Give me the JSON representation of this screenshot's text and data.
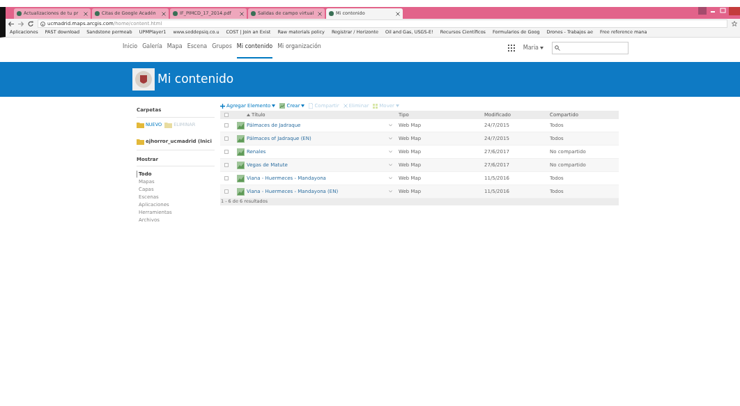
{
  "browser": {
    "tabs": [
      {
        "label": "Actualizaciones de tu pr",
        "selected": false
      },
      {
        "label": "Citas de Google Acadén",
        "selected": false
      },
      {
        "label": "IF_PIMCD_17_2014.pdf",
        "selected": false
      },
      {
        "label": "Salidas de campo virtual",
        "selected": false
      },
      {
        "label": "Mi contenido",
        "selected": true
      }
    ],
    "url_host": "ucmadrid.maps.arcgis.com",
    "url_path": "/home/content.html",
    "bookmarks": [
      "Aplicaciones",
      "PAST download",
      "Sandstone permeab",
      "UPMPlayer1",
      "www.seddepsiq.co.u",
      "COST | Join an Exist",
      "Raw materials policy",
      "Registrar / Horizonte",
      "Oil and Gas, USGS-E!",
      "Recursos Científicos",
      "Formularios de Goog",
      "Drones - Trabajos ae",
      "Free reference mana"
    ]
  },
  "nav": {
    "items": [
      {
        "label": "Inicio",
        "selected": false
      },
      {
        "label": "Galería",
        "selected": false
      },
      {
        "label": "Mapa",
        "selected": false
      },
      {
        "label": "Escena",
        "selected": false
      },
      {
        "label": "Grupos",
        "selected": false
      },
      {
        "label": "Mi contenido",
        "selected": true
      },
      {
        "label": "Mi organización",
        "selected": false
      }
    ],
    "user": "Maria"
  },
  "header": {
    "title": "Mi contenido"
  },
  "sidebar": {
    "folders_heading": "Carpetas",
    "folder_actions": [
      {
        "label": "NUEVO",
        "disabled": false
      },
      {
        "label": "ELIMINAR",
        "disabled": true
      }
    ],
    "folders": [
      "ejhorror_ucmadrid (Inici"
    ],
    "show_heading": "Mostrar",
    "filters": [
      {
        "label": "Todo",
        "selected": true
      },
      {
        "label": "Mapas",
        "selected": false
      },
      {
        "label": "Capas",
        "selected": false
      },
      {
        "label": "Escenas",
        "selected": false
      },
      {
        "label": "Aplicaciones",
        "selected": false
      },
      {
        "label": "Herramientas",
        "selected": false
      },
      {
        "label": "Archivos",
        "selected": false
      }
    ]
  },
  "toolbar": [
    {
      "label": "Agregar Elemento",
      "kind": "add",
      "disabled": false
    },
    {
      "label": "Crear",
      "kind": "create",
      "disabled": false
    },
    {
      "label": "Compartir",
      "kind": "share",
      "disabled": true
    },
    {
      "label": "Eliminar",
      "kind": "delete",
      "disabled": true
    },
    {
      "label": "Mover",
      "kind": "move",
      "disabled": true
    }
  ],
  "table": {
    "select_all_checked": false,
    "columns": [
      "Título",
      "Tipo",
      "Modificado",
      "Compartido"
    ],
    "rows": [
      {
        "title": "Pálmaces de Jadraque",
        "type": "Web Map",
        "modified": "24/7/2015",
        "shared": "Todos",
        "checked": false
      },
      {
        "title": "Pálmaces of Jadraque (EN)",
        "type": "Web Map",
        "modified": "24/7/2015",
        "shared": "Todos",
        "checked": false
      },
      {
        "title": "Renales",
        "type": "Web Map",
        "modified": "27/6/2017",
        "shared": "No compartido",
        "checked": false
      },
      {
        "title": "Vegas de Matute",
        "type": "Web Map",
        "modified": "27/6/2017",
        "shared": "No compartido",
        "checked": false
      },
      {
        "title": "Viana - Huermeces - Mandayona",
        "type": "Web Map",
        "modified": "11/5/2016",
        "shared": "Todos",
        "checked": false
      },
      {
        "title": "Viana - Huermeces - Mandayona (EN)",
        "type": "Web Map",
        "modified": "11/5/2016",
        "shared": "Todos",
        "checked": false
      }
    ],
    "footer": "1 - 6 de 6 resultados"
  }
}
